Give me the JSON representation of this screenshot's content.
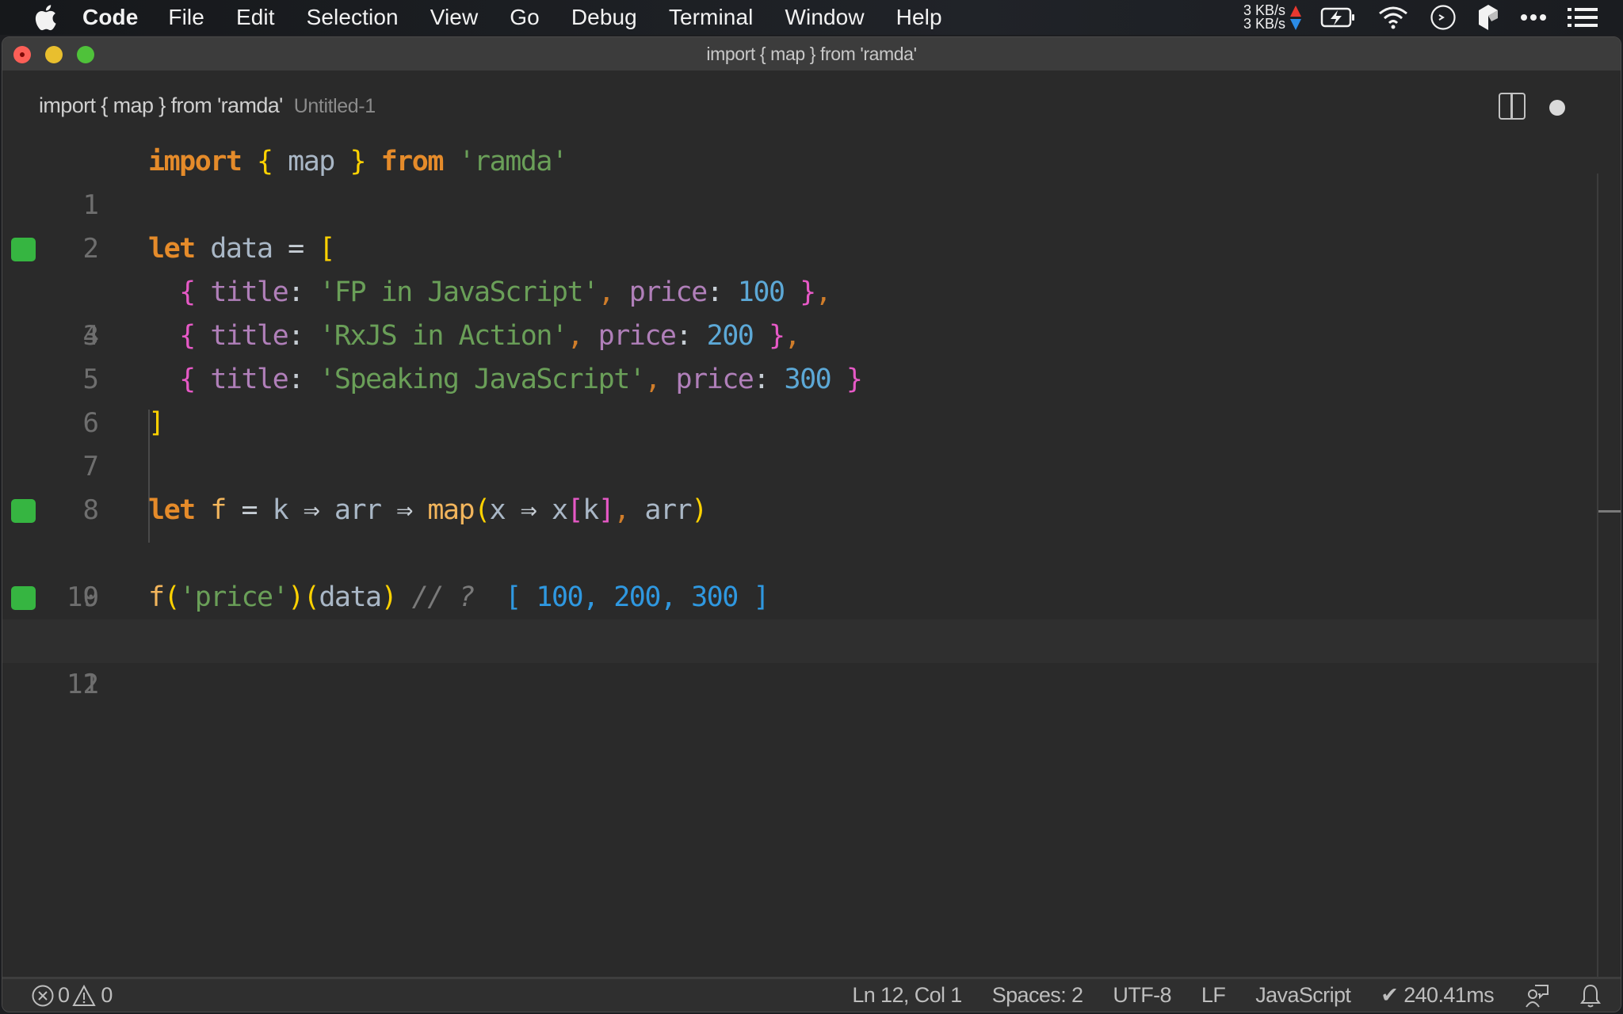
{
  "menubar": {
    "app_name": "Code",
    "items": [
      "File",
      "Edit",
      "Selection",
      "View",
      "Go",
      "Debug",
      "Terminal",
      "Window",
      "Help"
    ],
    "status": {
      "upload_speed": "3 KB/s",
      "download_speed": "3 KB/s",
      "upload_color": "#e8382f",
      "download_color": "#2b8ce6"
    }
  },
  "window": {
    "title": "import { map } from 'ramda'"
  },
  "tab": {
    "title": "import { map } from 'ramda'",
    "description": "Untitled-1",
    "dirty": true
  },
  "editor": {
    "current_line": 12,
    "gutter_marker_color": "#36b541",
    "lines": [
      {
        "n": "1",
        "marker": false
      },
      {
        "n": "2",
        "marker": false
      },
      {
        "n": "3",
        "marker": true
      },
      {
        "n": "4",
        "marker": false
      },
      {
        "n": "5",
        "marker": false
      },
      {
        "n": "6",
        "marker": false
      },
      {
        "n": "7",
        "marker": false
      },
      {
        "n": "8",
        "marker": false
      },
      {
        "n": "9",
        "marker": true
      },
      {
        "n": "10",
        "marker": false
      },
      {
        "n": "11",
        "marker": true
      },
      {
        "n": "12",
        "marker": false
      }
    ],
    "tokens": {
      "l1": [
        "import",
        " ",
        "{",
        " map ",
        "}",
        " ",
        "from",
        " ",
        "'ramda'"
      ],
      "l3": [
        "let",
        " data ",
        "=",
        " ",
        "["
      ],
      "l4": [
        "  ",
        "{",
        " ",
        "title",
        ":",
        " ",
        "'FP in JavaScript'",
        ",",
        " ",
        "price",
        ":",
        " ",
        "100",
        " ",
        "}",
        ","
      ],
      "l5": [
        "  ",
        "{",
        " ",
        "title",
        ":",
        " ",
        "'RxJS in Action'",
        ",",
        " ",
        "price",
        ":",
        " ",
        "200",
        " ",
        "}",
        ","
      ],
      "l6": [
        "  ",
        "{",
        " ",
        "title",
        ":",
        " ",
        "'Speaking JavaScript'",
        ",",
        " ",
        "price",
        ":",
        " ",
        "300",
        " ",
        "}"
      ],
      "l7": [
        "]"
      ],
      "l9": [
        "let",
        " ",
        "f",
        " ",
        "=",
        " k ",
        "⇒",
        " arr ",
        "⇒",
        " ",
        "map",
        "(",
        "x ",
        "⇒",
        " x",
        "[",
        "k",
        "]",
        ",",
        " arr",
        ")"
      ],
      "l11": [
        "f",
        "(",
        "'price'",
        ")",
        "(",
        "data",
        ")",
        " ",
        "// ?",
        "  ",
        "[ 100, 200, 300 ]"
      ]
    }
  },
  "statusbar": {
    "errors": "0",
    "warnings": "0",
    "position": "Ln 12, Col 1",
    "indent": "Spaces: 2",
    "encoding": "UTF-8",
    "eol": "LF",
    "language": "JavaScript",
    "quokka_time": "✔ 240.41ms"
  }
}
